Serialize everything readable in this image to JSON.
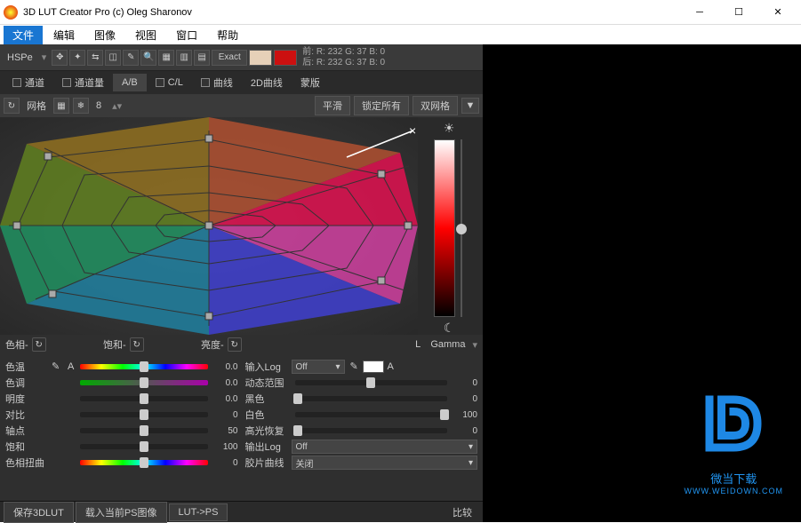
{
  "window": {
    "title": "3D LUT Creator Pro (c) Oleg Sharonov"
  },
  "menu": [
    "文件",
    "编辑",
    "图像",
    "视图",
    "窗口",
    "帮助"
  ],
  "toolbar1": {
    "mode": "HSPe",
    "exact_label": "Exact",
    "swatch1": "#e6d0b8",
    "swatch2": "#cc1010",
    "rgb_top": "前: R: 232   G: 37   B: 0",
    "rgb_bot": "后: R: 232   G: 37   B: 0"
  },
  "tabs": [
    {
      "label": "通道",
      "cb": true
    },
    {
      "label": "通道量",
      "cb": true
    },
    {
      "label": "A/B",
      "cb": false,
      "selected": true
    },
    {
      "label": "C/L",
      "cb": true
    },
    {
      "label": "曲线",
      "cb": true
    },
    {
      "label": "2D曲线",
      "cb": false
    },
    {
      "label": "蒙版",
      "cb": false
    }
  ],
  "gridbar": {
    "net_label": "网格",
    "grid_value": "8",
    "smooth": "平滑",
    "lock_all": "锁定所有",
    "dual_grid": "双网格"
  },
  "axis_labels": {
    "hue": "色相-",
    "sat": "饱和-",
    "lum": "亮度-",
    "gamma_prefix": "L",
    "gamma": "Gamma"
  },
  "params_left": [
    {
      "label": "色温",
      "value": "0.0",
      "pos": 50,
      "style": "plain"
    },
    {
      "label": "色调",
      "value": "0.0",
      "pos": 50,
      "style": "gb"
    },
    {
      "label": "明度",
      "value": "0.0",
      "pos": 50,
      "style": "plain"
    },
    {
      "label": "对比",
      "value": "0",
      "pos": 50,
      "style": "plain"
    },
    {
      "label": "轴点",
      "value": "50",
      "pos": 50,
      "style": "plain"
    },
    {
      "label": "饱和",
      "value": "100",
      "pos": 50,
      "style": "plain"
    },
    {
      "label": "色相扭曲",
      "value": "0",
      "pos": 50,
      "style": "rainbow"
    }
  ],
  "params_right": [
    {
      "label": "输入Log",
      "type": "row_with_dropdown",
      "dropdown": "Off",
      "auto": "A"
    },
    {
      "label": "动态范围",
      "type": "slider",
      "value": "0",
      "pos": 50
    },
    {
      "label": "黑色",
      "type": "slider",
      "value": "0",
      "pos": 2
    },
    {
      "label": "白色",
      "type": "slider",
      "value": "100",
      "pos": 98
    },
    {
      "label": "高光恢复",
      "type": "slider",
      "value": "0",
      "pos": 2
    },
    {
      "label": "输出Log",
      "type": "dropdown",
      "dropdown": "Off"
    },
    {
      "label": "胶片曲线",
      "type": "dropdown",
      "dropdown": "关闭"
    }
  ],
  "bottom": {
    "save": "保存3DLUT",
    "load_ps": "载入当前PS图像",
    "lut_ps": "LUT->PS",
    "compare": "比较"
  },
  "watermark": {
    "text": "微当下载",
    "url": "WWW.WEIDOWN.COM"
  }
}
